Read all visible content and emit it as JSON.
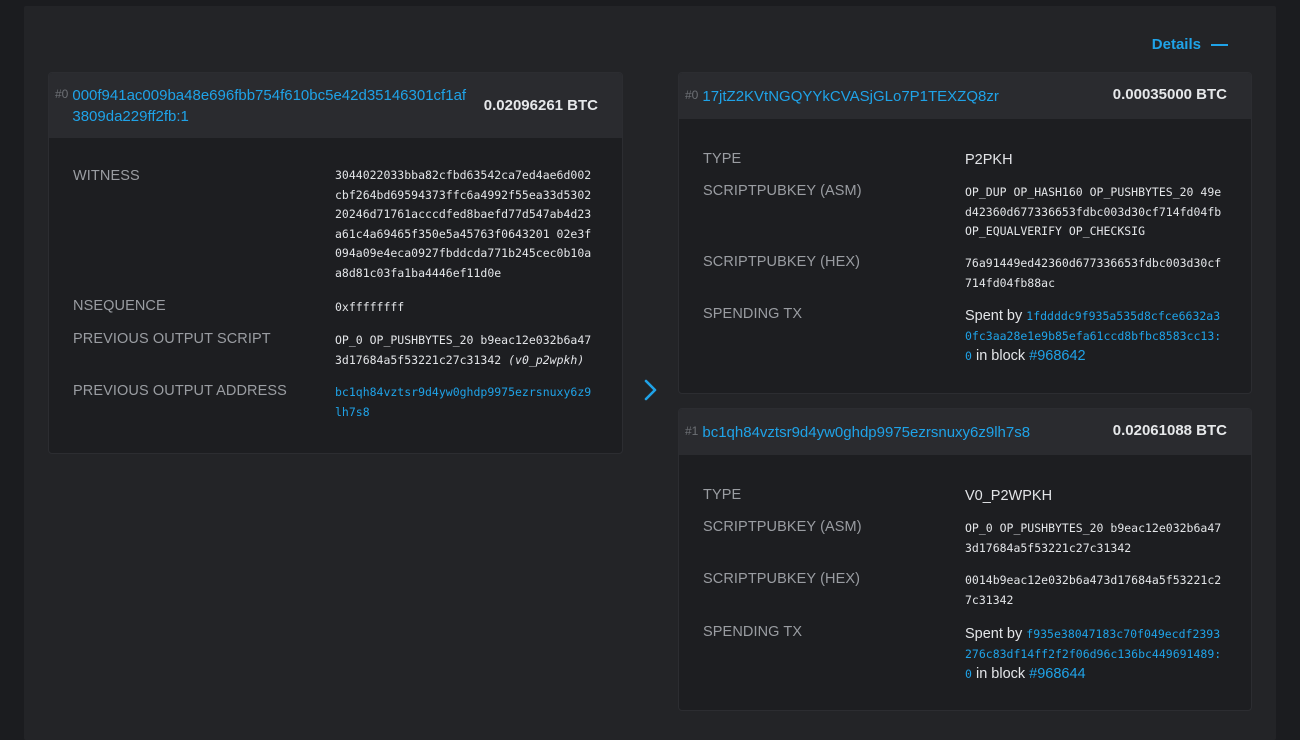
{
  "details": {
    "label": "Details"
  },
  "input": {
    "index": "#0",
    "txid": "000f941ac009ba48e696fbb754f610bc5e42d35146301cf1af3809da229ff2fb:1",
    "amount": "0.02096261 BTC",
    "rows": {
      "witness": {
        "label": "WITNESS",
        "value": "3044022033bba82cfbd63542ca7ed4ae6d002cbf264bd69594373ffc6a4992f55ea33d530220246d71761acccdfed8baefd77d547ab4d23a61c4a69465f350e5a45763f0643201 02e3f094a09e4eca0927fbddcda771b245cec0b10aa8d81c03fa1ba4446ef11d0e"
      },
      "nsequence": {
        "label": "NSEQUENCE",
        "value": "0xffffffff"
      },
      "prev_script": {
        "label": "PREVIOUS OUTPUT SCRIPT",
        "value": "OP_0 OP_PUSHBYTES_20 b9eac12e032b6a473d17684a5f53221c27c31342",
        "type": "(v0_p2wpkh)"
      },
      "prev_address": {
        "label": "PREVIOUS OUTPUT ADDRESS",
        "value": "bc1qh84vztsr9d4yw0ghdp9975ezrsnuxy6z9lh7s8"
      }
    }
  },
  "outputs": [
    {
      "index": "#0",
      "address": "17jtZ2KVtNGQYYkCVASjGLo7P1TEXZQ8zr",
      "amount": "0.00035000 BTC",
      "type_label": "TYPE",
      "type": "P2PKH",
      "asm_label": "SCRIPTPUBKEY (ASM)",
      "asm": "OP_DUP OP_HASH160 OP_PUSHBYTES_20 49ed42360d677336653fdbc003d30cf714fd04fb OP_EQUALVERIFY OP_CHECKSIG",
      "hex_label": "SCRIPTPUBKEY (HEX)",
      "hex": "76a91449ed42360d677336653fdbc003d30cf714fd04fb88ac",
      "spending_label": "SPENDING TX",
      "spent_by": "Spent by",
      "spent_tx": "1fddddc9f935a535d8cfce6632a30fc3aa28e1e9b85efa61ccd8bfbc8583cc13:0",
      "in_block": "in block",
      "block": "#968642"
    },
    {
      "index": "#1",
      "address": "bc1qh84vztsr9d4yw0ghdp9975ezrsnuxy6z9lh7s8",
      "amount": "0.02061088 BTC",
      "type_label": "TYPE",
      "type": "V0_P2WPKH",
      "asm_label": "SCRIPTPUBKEY (ASM)",
      "asm": "OP_0 OP_PUSHBYTES_20 b9eac12e032b6a473d17684a5f53221c27c31342",
      "hex_label": "SCRIPTPUBKEY (HEX)",
      "hex": "0014b9eac12e032b6a473d17684a5f53221c27c31342",
      "spending_label": "SPENDING TX",
      "spent_by": "Spent by",
      "spent_tx": "f935e38047183c70f049ecdf2393276c83df14ff2f2f06d96c136bc449691489:0",
      "in_block": "in block",
      "block": "#968644"
    }
  ],
  "colors": {
    "accent": "#1fa3e8",
    "background": "#1b1c1f",
    "panel": "#232427"
  },
  "icons": {
    "arrow": "chevron-right-icon"
  }
}
